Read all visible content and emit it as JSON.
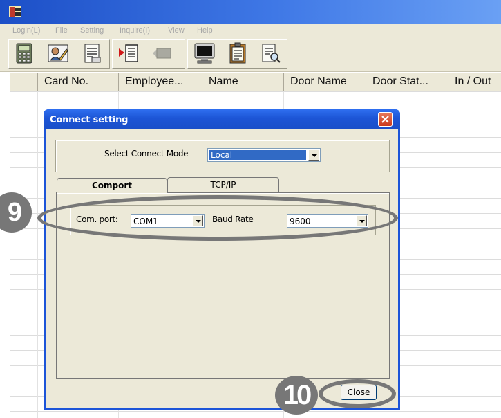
{
  "menu": [
    "Login(L)",
    "File",
    "Setting",
    "Inquire(I)",
    "View",
    "Help"
  ],
  "toolbar_icons": [
    "calculator-icon",
    "employee-edit-icon",
    "report-icon",
    "play-door-icon",
    "disabled-door-icon",
    "monitor-icon",
    "clipboard-icon",
    "search-document-icon"
  ],
  "grid": {
    "columns": [
      "",
      "Card No.",
      "Employee...",
      "Name",
      "Door Name",
      "Door Stat...",
      "In / Out"
    ]
  },
  "dialog": {
    "title": "Connect setting",
    "mode_label": "Select Connect Mode",
    "mode_value": "Local",
    "tabs": [
      "Comport",
      "TCP/IP"
    ],
    "active_tab": "Comport",
    "com_port_label": "Com. port:",
    "com_port_value": "COM1",
    "baud_label": "Baud Rate",
    "baud_value": "9600",
    "close_label": "Close"
  },
  "callouts": {
    "step_a": "9",
    "step_b": "10"
  },
  "colors": {
    "titlebar": "#1c4fc7",
    "dialog_title": "#1c55d6",
    "window_face": "#ece9d8",
    "callout": "#777777",
    "selection": "#316ac5"
  }
}
